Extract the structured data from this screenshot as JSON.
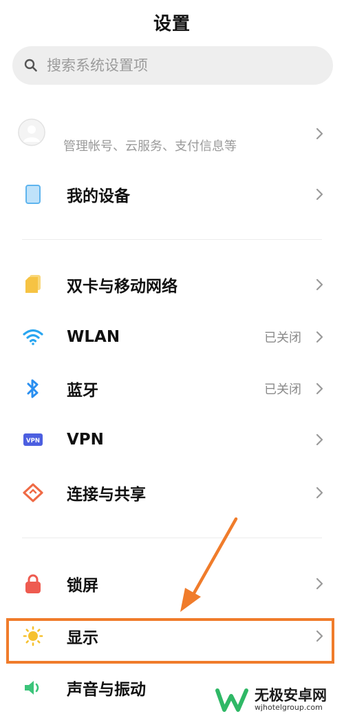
{
  "header": {
    "title": "设置"
  },
  "search": {
    "placeholder": "搜索系统设置项"
  },
  "account": {
    "subtitle": "管理帐号、云服务、支付信息等"
  },
  "device": {
    "label": "我的设备"
  },
  "network": [
    {
      "id": "sim",
      "label": "双卡与移动网络",
      "value": "",
      "icon": "sim-card-icon"
    },
    {
      "id": "wlan",
      "label": "WLAN",
      "value": "已关闭",
      "icon": "wifi-icon"
    },
    {
      "id": "bluetooth",
      "label": "蓝牙",
      "value": "已关闭",
      "icon": "bluetooth-icon"
    },
    {
      "id": "vpn",
      "label": "VPN",
      "value": "",
      "icon": "vpn-icon"
    },
    {
      "id": "share",
      "label": "连接与共享",
      "value": "",
      "icon": "share-icon"
    }
  ],
  "system": [
    {
      "id": "lock",
      "label": "锁屏",
      "icon": "lock-icon"
    },
    {
      "id": "display",
      "label": "显示",
      "icon": "sun-icon"
    },
    {
      "id": "sound",
      "label": "声音与振动",
      "icon": "speaker-icon"
    }
  ],
  "watermark": {
    "name": "无极安卓网",
    "url": "wjhotelgroup.com"
  },
  "colors": {
    "annotation": "#f07c2b",
    "sim": "#f6c343",
    "wifi": "#2aa6f0",
    "bluetooth": "#2a8ff0",
    "vpn": "#4c5fe0",
    "share": "#ef6a45",
    "lock": "#ee5b50",
    "sun": "#f6c12f",
    "speaker": "#3cc47a",
    "device": "#5eb4ee"
  }
}
